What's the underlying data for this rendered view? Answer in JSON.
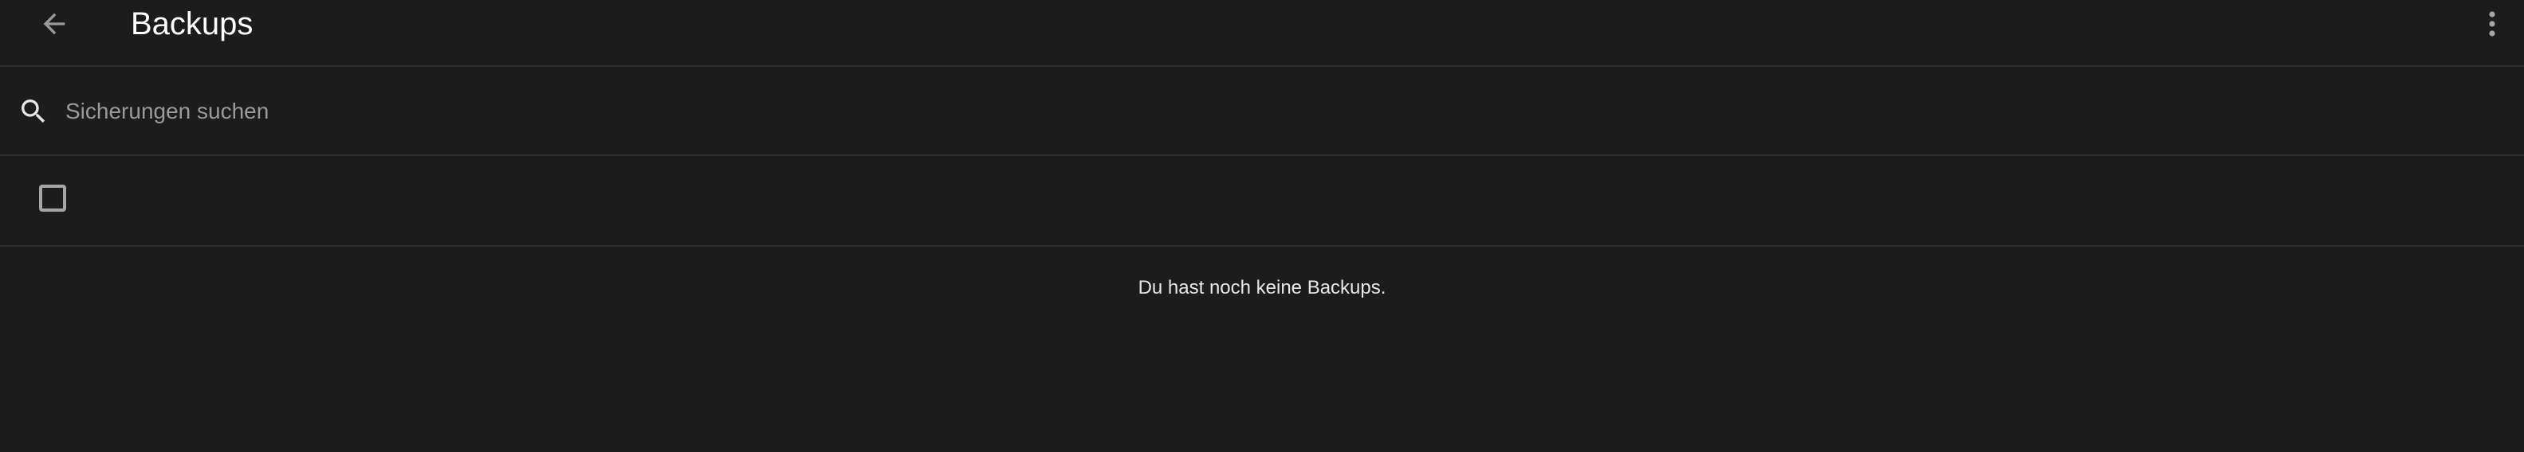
{
  "header": {
    "title": "Backups",
    "back_icon": "arrow-left-icon",
    "overflow_icon": "more-vertical-icon"
  },
  "search": {
    "placeholder": "Sicherungen suchen",
    "value": "",
    "icon": "search-icon"
  },
  "selection": {
    "select_all_checked": false
  },
  "empty_state": {
    "message": "Du hast noch keine Backups."
  },
  "colors": {
    "background": "#1c1c1c",
    "divider": "#2f2f2f",
    "title_text": "#ffffff",
    "body_text": "#e8e8e8",
    "placeholder_text": "#9a9a9a",
    "icon": "#a6a6a6"
  }
}
